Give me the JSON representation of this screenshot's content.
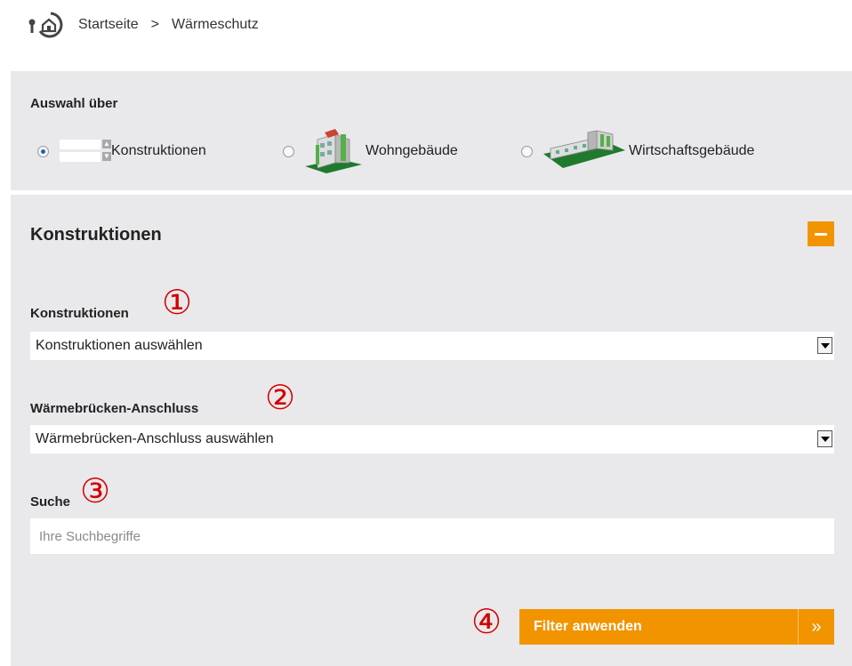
{
  "breadcrumb": {
    "items": [
      "Startseite",
      "Wärmeschutz"
    ],
    "separator": ">"
  },
  "selection": {
    "title": "Auswahl über",
    "options": [
      {
        "label": "Konstruktionen",
        "checked": true
      },
      {
        "label": "Wohngebäude",
        "checked": false
      },
      {
        "label": "Wirtschaftsgebäude",
        "checked": false
      }
    ]
  },
  "filter": {
    "title": "Konstruktionen",
    "fields": [
      {
        "label": "Konstruktionen",
        "marker": "①",
        "value": "Konstruktionen auswählen"
      },
      {
        "label": "Wärmebrücken-Anschluss",
        "marker": "②",
        "value": "Wärmebrücken-Anschluss auswählen"
      }
    ],
    "search": {
      "label": "Suche",
      "marker": "③",
      "placeholder": "Ihre Suchbegriffe"
    },
    "apply": {
      "marker": "④",
      "label": "Filter anwenden",
      "arrow": "»"
    }
  },
  "colors": {
    "accent": "#f29400",
    "panel": "#e9e9eb",
    "marker": "#d40000"
  }
}
